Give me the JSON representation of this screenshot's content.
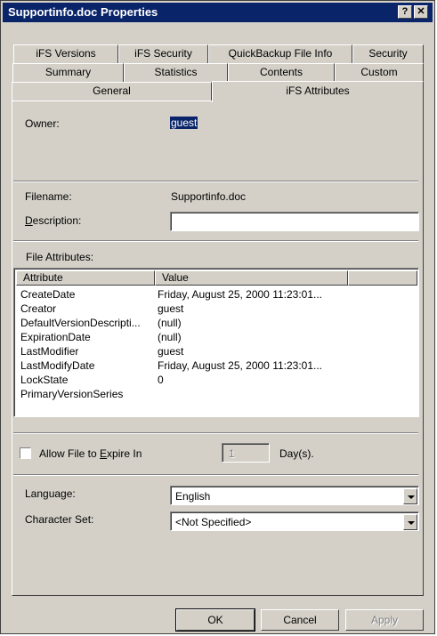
{
  "window": {
    "title": "Supportinfo.doc Properties",
    "help_button": "?",
    "close_button": "✕"
  },
  "tabs": {
    "row1": [
      "iFS Versions",
      "iFS Security",
      "QuickBackup File Info",
      "Security"
    ],
    "row2": [
      "Summary",
      "Statistics",
      "Contents",
      "Custom"
    ],
    "row3": [
      "General",
      "iFS Attributes"
    ],
    "active": "iFS Attributes"
  },
  "owner": {
    "label": "Owner:",
    "value": "guest"
  },
  "filename": {
    "label": "Filename:",
    "value": "Supportinfo.doc"
  },
  "description": {
    "label_pre": "",
    "label_accel": "D",
    "label_post": "escription:",
    "value": ""
  },
  "file_attributes": {
    "label": "File Attributes:",
    "columns": [
      "Attribute",
      "Value"
    ],
    "rows": [
      {
        "attribute": "CreateDate",
        "value": "Friday, August 25, 2000 11:23:01..."
      },
      {
        "attribute": "Creator",
        "value": "guest"
      },
      {
        "attribute": "DefaultVersionDescripti...",
        "value": "(null)"
      },
      {
        "attribute": "ExpirationDate",
        "value": "(null)"
      },
      {
        "attribute": "LastModifier",
        "value": "guest"
      },
      {
        "attribute": "LastModifyDate",
        "value": "Friday, August 25, 2000 11:23:01..."
      },
      {
        "attribute": "LockState",
        "value": "0"
      },
      {
        "attribute": "PrimaryVersionSeries",
        "value": ""
      }
    ]
  },
  "expire": {
    "label_pre": "Allow File to ",
    "label_accel": "E",
    "label_post": "xpire In",
    "checked": false,
    "days_value": "1",
    "days_label": "Day(s)."
  },
  "language": {
    "label": "Language:",
    "value": "English"
  },
  "charset": {
    "label": "Character Set:",
    "value": "<Not Specified>"
  },
  "buttons": {
    "ok": "OK",
    "cancel": "Cancel",
    "apply": "Apply"
  },
  "colors": {
    "titlebar": "#0a246a",
    "face": "#d4d0c8",
    "selection": "#0a246a"
  }
}
